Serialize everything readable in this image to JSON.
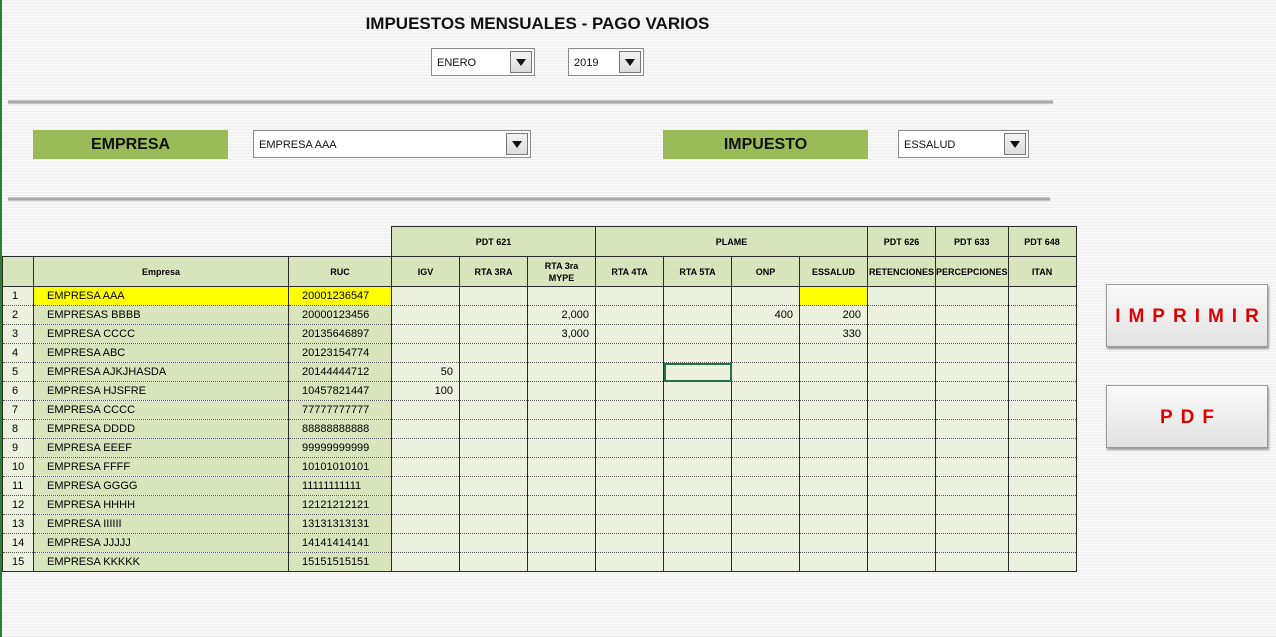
{
  "title": "IMPUESTOS MENSUALES - PAGO VARIOS",
  "filters": {
    "month": "ENERO",
    "year": "2019"
  },
  "empresa": {
    "label": "EMPRESA",
    "selected": "EMPRESA AAA"
  },
  "impuesto": {
    "label": "IMPUESTO",
    "selected": "ESSALUD"
  },
  "buttons": {
    "print": "IMPRIMIR",
    "pdf": "PDF"
  },
  "table": {
    "group_headers": {
      "pdt621": "PDT 621",
      "plame": "PLAME",
      "pdt626": "PDT 626",
      "pdt633": "PDT 633",
      "pdt648": "PDT 648"
    },
    "columns": {
      "empresa": "Empresa",
      "ruc": "RUC",
      "igv": "IGV",
      "rta3ra": "RTA 3RA",
      "rta3ra_mype_l1": "RTA 3ra",
      "rta3ra_mype_l2": "MYPE",
      "rta4ta": "RTA 4TA",
      "rta5ta": "RTA 5TA",
      "onp": "ONP",
      "essalud": "ESSALUD",
      "retenciones": "RETENCIONES",
      "percepciones": "PERCEPCIONES",
      "itan": "ITAN"
    },
    "rows": [
      {
        "n": "1",
        "empresa": "EMPRESA AAA",
        "ruc": "20001236547",
        "igv": "",
        "rta3ra": "",
        "mype": "",
        "rta4ta": "",
        "rta5ta": "",
        "onp": "",
        "essalud": "",
        "ret": "",
        "perc": "",
        "itan": ""
      },
      {
        "n": "2",
        "empresa": "EMPRESAS BBBB",
        "ruc": "20000123456",
        "igv": "",
        "rta3ra": "",
        "mype": "2,000",
        "rta4ta": "",
        "rta5ta": "",
        "onp": "400",
        "essalud": "200",
        "ret": "",
        "perc": "",
        "itan": ""
      },
      {
        "n": "3",
        "empresa": "EMPRESA CCCC",
        "ruc": "20135646897",
        "igv": "",
        "rta3ra": "",
        "mype": "3,000",
        "rta4ta": "",
        "rta5ta": "",
        "onp": "",
        "essalud": "330",
        "ret": "",
        "perc": "",
        "itan": ""
      },
      {
        "n": "4",
        "empresa": "EMPRESA ABC",
        "ruc": "20123154774",
        "igv": "",
        "rta3ra": "",
        "mype": "",
        "rta4ta": "",
        "rta5ta": "",
        "onp": "",
        "essalud": "",
        "ret": "",
        "perc": "",
        "itan": ""
      },
      {
        "n": "5",
        "empresa": "EMPRESA AJKJHASDA",
        "ruc": "20144444712",
        "igv": "50",
        "rta3ra": "",
        "mype": "",
        "rta4ta": "",
        "rta5ta": "",
        "onp": "",
        "essalud": "",
        "ret": "",
        "perc": "",
        "itan": ""
      },
      {
        "n": "6",
        "empresa": "EMPRESA HJSFRE",
        "ruc": "10457821447",
        "igv": "100",
        "rta3ra": "",
        "mype": "",
        "rta4ta": "",
        "rta5ta": "",
        "onp": "",
        "essalud": "",
        "ret": "",
        "perc": "",
        "itan": ""
      },
      {
        "n": "7",
        "empresa": "EMPRESA CCCC",
        "ruc": "77777777777",
        "igv": "",
        "rta3ra": "",
        "mype": "",
        "rta4ta": "",
        "rta5ta": "",
        "onp": "",
        "essalud": "",
        "ret": "",
        "perc": "",
        "itan": ""
      },
      {
        "n": "8",
        "empresa": "EMPRESA DDDD",
        "ruc": "88888888888",
        "igv": "",
        "rta3ra": "",
        "mype": "",
        "rta4ta": "",
        "rta5ta": "",
        "onp": "",
        "essalud": "",
        "ret": "",
        "perc": "",
        "itan": ""
      },
      {
        "n": "9",
        "empresa": "EMPRESA EEEF",
        "ruc": "99999999999",
        "igv": "",
        "rta3ra": "",
        "mype": "",
        "rta4ta": "",
        "rta5ta": "",
        "onp": "",
        "essalud": "",
        "ret": "",
        "perc": "",
        "itan": ""
      },
      {
        "n": "10",
        "empresa": "EMPRESA FFFF",
        "ruc": "10101010101",
        "igv": "",
        "rta3ra": "",
        "mype": "",
        "rta4ta": "",
        "rta5ta": "",
        "onp": "",
        "essalud": "",
        "ret": "",
        "perc": "",
        "itan": ""
      },
      {
        "n": "11",
        "empresa": "EMPRESA GGGG",
        "ruc": "11111111111",
        "igv": "",
        "rta3ra": "",
        "mype": "",
        "rta4ta": "",
        "rta5ta": "",
        "onp": "",
        "essalud": "",
        "ret": "",
        "perc": "",
        "itan": ""
      },
      {
        "n": "12",
        "empresa": "EMPRESA HHHH",
        "ruc": "12121212121",
        "igv": "",
        "rta3ra": "",
        "mype": "",
        "rta4ta": "",
        "rta5ta": "",
        "onp": "",
        "essalud": "",
        "ret": "",
        "perc": "",
        "itan": ""
      },
      {
        "n": "13",
        "empresa": "EMPRESA IIIIII",
        "ruc": "13131313131",
        "igv": "",
        "rta3ra": "",
        "mype": "",
        "rta4ta": "",
        "rta5ta": "",
        "onp": "",
        "essalud": "",
        "ret": "",
        "perc": "",
        "itan": ""
      },
      {
        "n": "14",
        "empresa": "EMPRESA JJJJJ",
        "ruc": "14141414141",
        "igv": "",
        "rta3ra": "",
        "mype": "",
        "rta4ta": "",
        "rta5ta": "",
        "onp": "",
        "essalud": "",
        "ret": "",
        "perc": "",
        "itan": ""
      },
      {
        "n": "15",
        "empresa": "EMPRESA KKKKK",
        "ruc": "15151515151",
        "igv": "",
        "rta3ra": "",
        "mype": "",
        "rta4ta": "",
        "rta5ta": "",
        "onp": "",
        "essalud": "",
        "ret": "",
        "perc": "",
        "itan": ""
      }
    ]
  }
}
